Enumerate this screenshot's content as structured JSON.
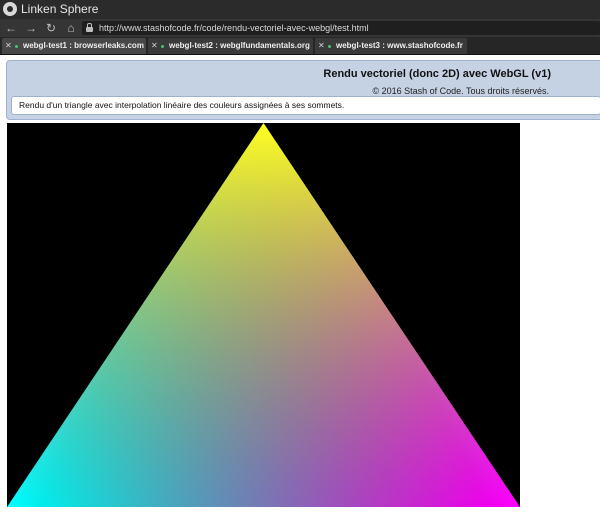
{
  "window": {
    "title": "Linken Sphere",
    "logo_icon": "sphere-logo-icon"
  },
  "navigation": {
    "back_icon": "arrow-left-icon",
    "forward_icon": "arrow-right-icon",
    "reload_icon": "reload-icon",
    "home_icon": "home-icon",
    "lock_icon": "lock-icon",
    "url": "http://www.stashofcode.fr/code/rendu-vectoriel-avec-webgl/test.html"
  },
  "tabs": [
    {
      "label": "webgl-test1 : browserleaks.com",
      "active": true
    },
    {
      "label": "webgl-test2 : webglfundamentals.org",
      "active": false
    },
    {
      "label": "webgl-test3 : www.stashofcode.fr",
      "active": false
    }
  ],
  "page": {
    "title": "Rendu vectoriel (donc 2D) avec WebGL (v1)",
    "copyright": "© 2016 Stash of Code. Tous droits réservés.",
    "description": "Rendu d'un triangle avec interpolation linéaire des couleurs assignées à ses sommets."
  },
  "canvas": {
    "background": "#000000",
    "vertex_colors": {
      "top": "#ffff00",
      "bottom_left": "#00ffff",
      "bottom_right": "#ff00ff"
    }
  },
  "colors": {
    "panel_background": "#c5d2e4",
    "panel_border": "#9fb1cc",
    "chrome_dark": "#2b2b2b"
  }
}
